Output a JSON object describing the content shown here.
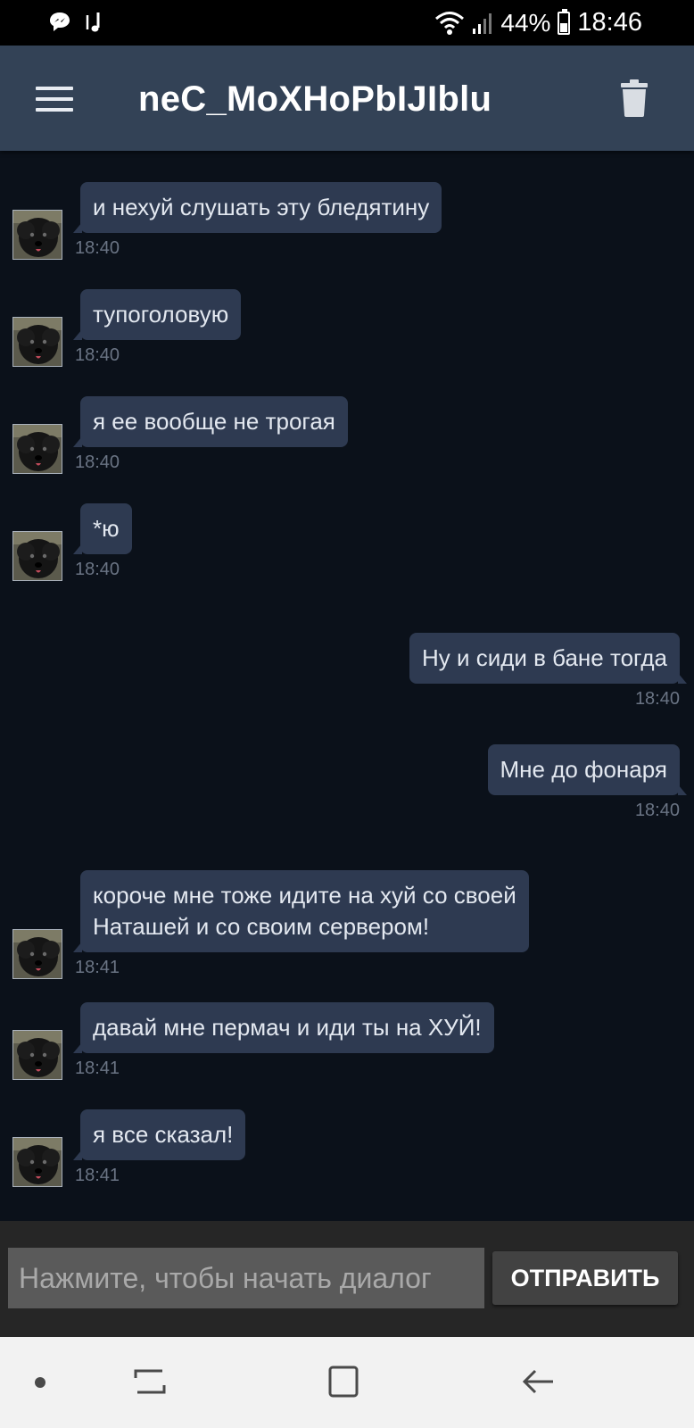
{
  "status_bar": {
    "battery": "44%",
    "time": "18:46",
    "icons": [
      "messenger-icon",
      "music-icon",
      "wifi-icon",
      "signal-icon",
      "battery-icon"
    ]
  },
  "header": {
    "title": "neC_MoXHoPbIJIblu",
    "left_icon": "menu-icon",
    "right_icon": "trash-icon"
  },
  "messages": [
    {
      "direction": "in",
      "text": "и нехуй слушать эту бледятину",
      "time": "18:40"
    },
    {
      "direction": "in",
      "text": "тупоголовую",
      "time": "18:40"
    },
    {
      "direction": "in",
      "text": "я ее вообще не трогая",
      "time": "18:40"
    },
    {
      "direction": "in",
      "text": "*ю",
      "time": "18:40"
    },
    {
      "direction": "out",
      "text": "Ну и сиди в бане тогда",
      "time": "18:40"
    },
    {
      "direction": "out",
      "text": "Мне до фонаря",
      "time": "18:40"
    },
    {
      "direction": "in",
      "text": "короче мне тоже идите на хуй со своей\nНаташей и со своим сервером!",
      "time": "18:41"
    },
    {
      "direction": "in",
      "text": "давай мне пермач и иди ты на ХУЙ!",
      "time": "18:41"
    },
    {
      "direction": "in",
      "text": "я все сказал!",
      "time": "18:41"
    }
  ],
  "composer": {
    "placeholder": "Нажмите, чтобы начать диалог",
    "send_label": "ОТПРАВИТЬ"
  },
  "nav_bar": {
    "icons": [
      "dot-icon",
      "recent-apps-icon",
      "home-icon",
      "back-icon"
    ]
  },
  "colors": {
    "background": "#0b111a",
    "header": "#334256",
    "bubble": "#2e3a51",
    "timestamp": "#6a7484"
  }
}
